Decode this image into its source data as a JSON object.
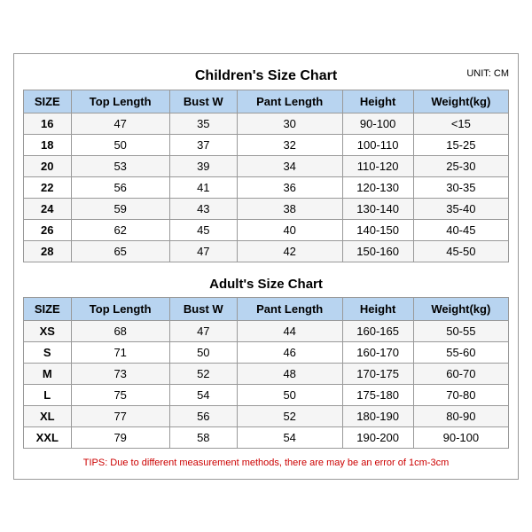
{
  "children_title": "Children's Size Chart",
  "adult_title": "Adult's Size Chart",
  "unit": "UNIT: CM",
  "children_headers": [
    "SIZE",
    "Top Length",
    "Bust W",
    "Pant Length",
    "Height",
    "Weight(kg)"
  ],
  "children_rows": [
    [
      "16",
      "47",
      "35",
      "30",
      "90-100",
      "<15"
    ],
    [
      "18",
      "50",
      "37",
      "32",
      "100-110",
      "15-25"
    ],
    [
      "20",
      "53",
      "39",
      "34",
      "110-120",
      "25-30"
    ],
    [
      "22",
      "56",
      "41",
      "36",
      "120-130",
      "30-35"
    ],
    [
      "24",
      "59",
      "43",
      "38",
      "130-140",
      "35-40"
    ],
    [
      "26",
      "62",
      "45",
      "40",
      "140-150",
      "40-45"
    ],
    [
      "28",
      "65",
      "47",
      "42",
      "150-160",
      "45-50"
    ]
  ],
  "adult_headers": [
    "SIZE",
    "Top Length",
    "Bust W",
    "Pant Length",
    "Height",
    "Weight(kg)"
  ],
  "adult_rows": [
    [
      "XS",
      "68",
      "47",
      "44",
      "160-165",
      "50-55"
    ],
    [
      "S",
      "71",
      "50",
      "46",
      "160-170",
      "55-60"
    ],
    [
      "M",
      "73",
      "52",
      "48",
      "170-175",
      "60-70"
    ],
    [
      "L",
      "75",
      "54",
      "50",
      "175-180",
      "70-80"
    ],
    [
      "XL",
      "77",
      "56",
      "52",
      "180-190",
      "80-90"
    ],
    [
      "XXL",
      "79",
      "58",
      "54",
      "190-200",
      "90-100"
    ]
  ],
  "tips": "TIPS: Due to different measurement methods, there are may be an error of 1cm-3cm"
}
